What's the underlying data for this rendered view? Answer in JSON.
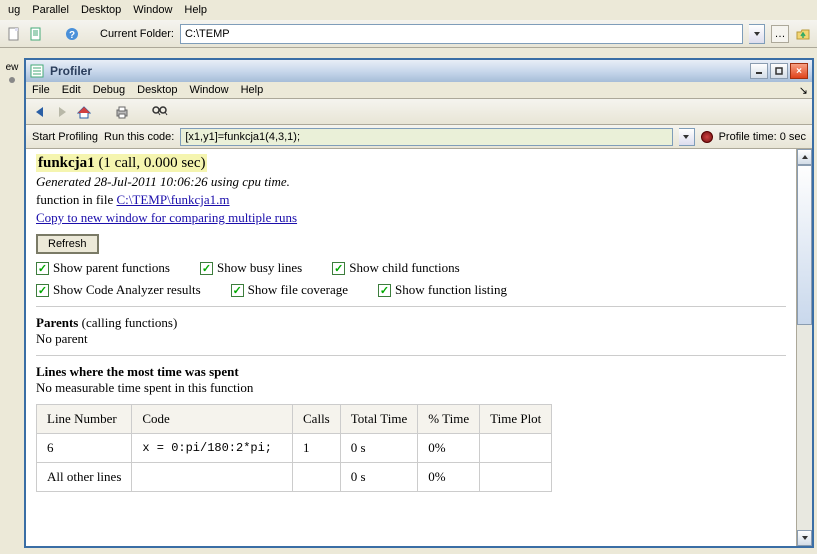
{
  "outer_menu": {
    "items": [
      "ug",
      "Parallel",
      "Desktop",
      "Window",
      "Help"
    ]
  },
  "outer_toolbar": {
    "current_folder_label": "Current Folder:",
    "current_folder_value": "C:\\TEMP"
  },
  "left_tab": "ew",
  "profiler": {
    "title": "Profiler",
    "menu": [
      "File",
      "Edit",
      "Debug",
      "Desktop",
      "Window",
      "Help"
    ],
    "tb2": {
      "start_label": "Start Profiling",
      "run_label": "Run this code:",
      "code_value": "[x1,y1]=funkcja1(4,3,1);",
      "profile_time": "Profile time: 0 sec"
    },
    "content": {
      "title_fn": "funkcja1",
      "title_stats": " (1 call, 0.000 sec)",
      "generated": "Generated 28-Jul-2011 10:06:26 using cpu time.",
      "file_prefix": "function in file ",
      "file_link": "C:\\TEMP\\funkcja1.m",
      "copy_link": "Copy to new window for comparing multiple runs",
      "refresh": "Refresh",
      "chk1": [
        "Show parent functions",
        "Show busy lines",
        "Show child functions"
      ],
      "chk2": [
        "Show Code Analyzer results",
        "Show file coverage",
        "Show function listing"
      ],
      "parents_head": "Parents ",
      "parents_paren": "(calling functions)",
      "parents_body": "No parent",
      "lines_head": "Lines where the most time was spent",
      "lines_body": "No measurable time spent in this function",
      "table": {
        "headers": [
          "Line Number",
          "Code",
          "Calls",
          "Total Time",
          "% Time",
          "Time Plot"
        ],
        "rows": [
          {
            "line": "6",
            "code": "x = 0:pi/180:2*pi;",
            "calls": "1",
            "total": "0 s",
            "pct": "0%",
            "plot": ""
          },
          {
            "line": "All other lines",
            "code": "",
            "calls": "",
            "total": "0 s",
            "pct": "0%",
            "plot": ""
          }
        ]
      }
    }
  }
}
